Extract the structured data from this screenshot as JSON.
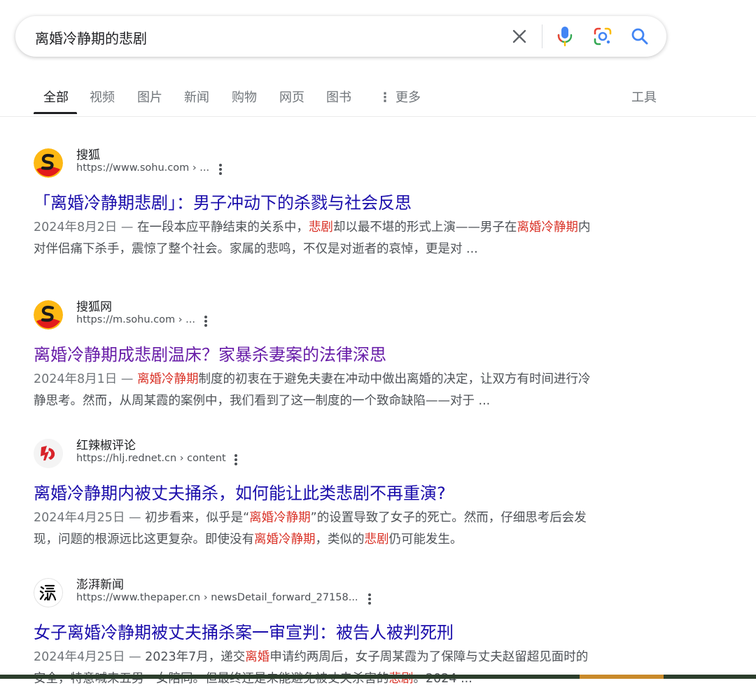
{
  "search": {
    "query": "离婚冷静期的悲剧"
  },
  "tabs": [
    {
      "label": "全部"
    },
    {
      "label": "视频"
    },
    {
      "label": "图片"
    },
    {
      "label": "新闻"
    },
    {
      "label": "购物"
    },
    {
      "label": "网页"
    },
    {
      "label": "图书"
    },
    {
      "label": "更多"
    },
    {
      "label": "工具"
    }
  ],
  "results": [
    {
      "site": "搜狐",
      "url": "https://www.sohu.com › ...",
      "title": "「离婚冷静期悲剧」：男子冲动下的杀戮与社会反思",
      "date": "2024年8月2日 —",
      "snippet": [
        {
          "t": " 在一段本应平静结束的关系中，"
        },
        {
          "t": "悲剧",
          "hl": true
        },
        {
          "t": "却以最不堪的形式上演——男子在"
        },
        {
          "t": "离婚冷静期",
          "hl": true
        },
        {
          "t": "内对伴侣痛下杀手，震惊了整个社会。家属的悲鸣，不仅是对逝者的哀悼，更是对 ..."
        }
      ],
      "icon": "sohu-logo-icon"
    },
    {
      "site": "搜狐网",
      "url": "https://m.sohu.com › ...",
      "title": "离婚冷静期成悲剧温床？家暴杀妻案的法律深思",
      "date": "2024年8月1日 —",
      "snippet": [
        {
          "t": " "
        },
        {
          "t": "离婚冷静期",
          "hl": true
        },
        {
          "t": "制度的初衷在于避免夫妻在冲动中做出离婚的决定，让双方有时间进行冷静思考。然而，从周某霞的案例中，我们看到了这一制度的一个致命缺陷——对于 ..."
        }
      ],
      "icon": "sohu-logo-icon"
    },
    {
      "site": "红辣椒评论",
      "url": "https://hlj.rednet.cn › content",
      "title": "离婚冷静期内被丈夫捅杀，如何能让此类悲剧不再重演?",
      "date": "2024年4月25日 —",
      "snippet": [
        {
          "t": " 初步看来，似乎是“"
        },
        {
          "t": "离婚冷静期",
          "hl": true
        },
        {
          "t": "”的设置导致了女子的死亡。然而，仔细思考后会发现，问题的根源远比这更复杂。即使没有"
        },
        {
          "t": "离婚冷静期",
          "hl": true
        },
        {
          "t": "，类似的"
        },
        {
          "t": "悲剧",
          "hl": true
        },
        {
          "t": "仍可能发生。"
        }
      ],
      "icon": "rednet-logo-icon"
    },
    {
      "site": "澎湃新闻",
      "url": "https://www.thepaper.cn › newsDetail_forward_27158...",
      "title": "女子离婚冷静期被丈夫捅杀案一审宣判：被告人被判死刑",
      "date": "2024年4月25日 —",
      "snippet": [
        {
          "t": " 2023年7月，递交"
        },
        {
          "t": "离婚",
          "hl": true
        },
        {
          "t": "申请约两周后，女子周某霞为了保障与丈夫赵留超见面时的安全，特意喊来五男一女陪同。但最终还是未能避免被丈夫杀害的"
        },
        {
          "t": "悲剧",
          "hl": true
        },
        {
          "t": "。2024 ..."
        }
      ],
      "icon": "thepaper-logo-icon"
    }
  ],
  "colors": {
    "link_unvisited": "#1a0dab",
    "link_visited": "#681da8",
    "highlight": "#d93025",
    "snippet_text": "#4d5156"
  }
}
